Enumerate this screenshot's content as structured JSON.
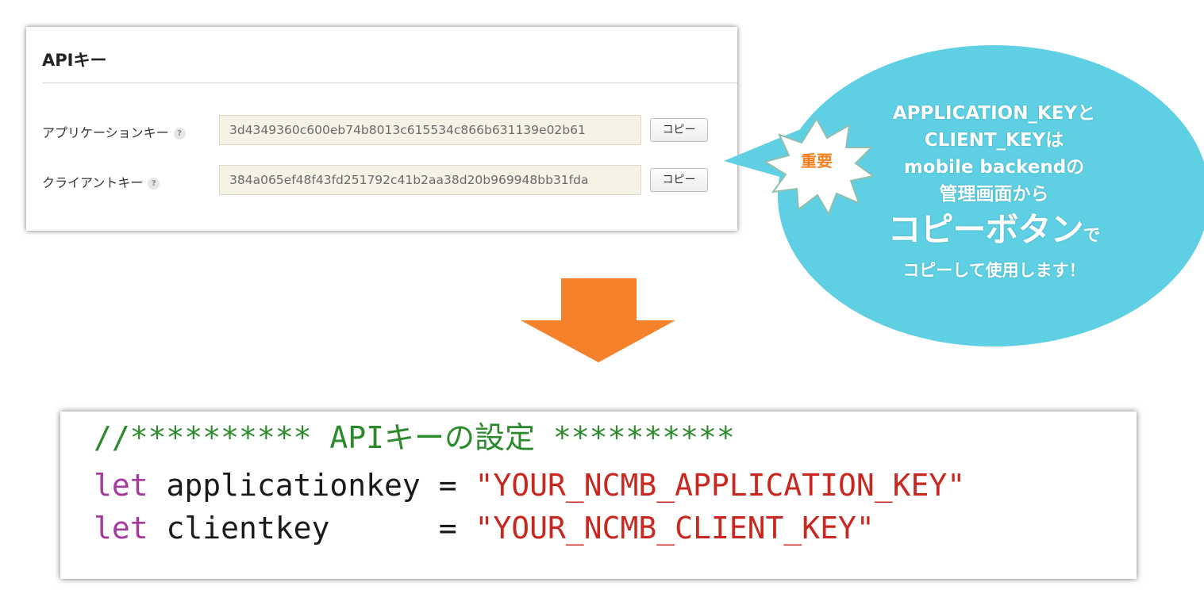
{
  "api_panel": {
    "title": "APIキー",
    "rows": [
      {
        "label": "アプリケーションキー",
        "help": "?",
        "value": "3d4349360c600eb74b8013c615534c866b631139e02b61",
        "copy_label": "コピー"
      },
      {
        "label": "クライアントキー",
        "help": "?",
        "value": "384a065ef48f43fd251792c41b2aa38d20b969948bb31fda",
        "copy_label": "コピー"
      }
    ]
  },
  "callout": {
    "badge": "重要",
    "line1": "APPLICATION_KEYと",
    "line2": "CLIENT_KEYは",
    "line3": "mobile backendの",
    "line4": "管理画面から",
    "big": "コピーボタン",
    "big_suffix": "で",
    "last": "コピーして使用します！",
    "bubble_color": "#5fd0e3",
    "badge_color": "#f4801f"
  },
  "arrow": {
    "color": "#f5822a",
    "icon": "down-arrow-icon"
  },
  "code": {
    "comment": "//********** APIキーの設定 **********",
    "line2_kw": "let",
    "line2_name": " applicationkey = ",
    "line2_str": "\"YOUR_NCMB_APPLICATION_KEY\"",
    "line3_kw": "let",
    "line3_name": " clientkey      = ",
    "line3_str": "\"YOUR_NCMB_CLIENT_KEY\""
  }
}
